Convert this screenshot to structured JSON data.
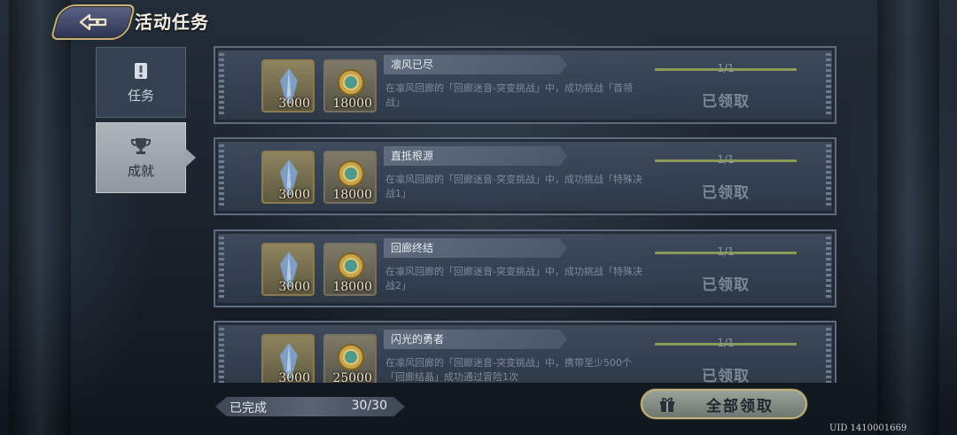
{
  "header": {
    "title": "活动任务"
  },
  "tabs": [
    {
      "label": "任务",
      "active": false
    },
    {
      "label": "成就",
      "active": true
    }
  ],
  "quests": [
    {
      "name": "凛风已尽",
      "description": "在凛风回廊的「回廊迷音-突变挑战」中，成功挑战「首领战」",
      "rewards": [
        "3000",
        "18000"
      ],
      "progress_text": "1/1",
      "progress": 1.0,
      "status": "已领取"
    },
    {
      "name": "直抵根源",
      "description": "在凛风回廊的「回廊迷音-突变挑战」中，成功挑战「特殊决战1」",
      "rewards": [
        "3000",
        "18000"
      ],
      "progress_text": "1/1",
      "progress": 1.0,
      "status": "已领取"
    },
    {
      "name": "回廊终结",
      "description": "在凛风回廊的「回廊迷音-突变挑战」中，成功挑战「特殊决战2」",
      "rewards": [
        "3000",
        "18000"
      ],
      "progress_text": "1/1",
      "progress": 1.0,
      "status": "已领取"
    },
    {
      "name": "闪光的勇者",
      "description": "在凛风回廊的「回廊迷音-突变挑战」中，携带至少500个「回廊结晶」成功通过冒险1次",
      "rewards": [
        "3000",
        "25000"
      ],
      "progress_text": "1/1",
      "progress": 1.0,
      "status": "已领取"
    }
  ],
  "footer": {
    "completed_label": "已完成",
    "completed_value": "30/30",
    "claim_all_label": "全部领取",
    "uid": "UID 1410001669"
  },
  "colors": {
    "accent_gold": "#c9b27a",
    "progress_fill": "#8d9a57"
  },
  "icons": [
    "back-arrow-icon",
    "task-scroll-icon",
    "trophy-icon",
    "crystal-reward-icon",
    "coin-reward-icon",
    "gift-icon"
  ]
}
